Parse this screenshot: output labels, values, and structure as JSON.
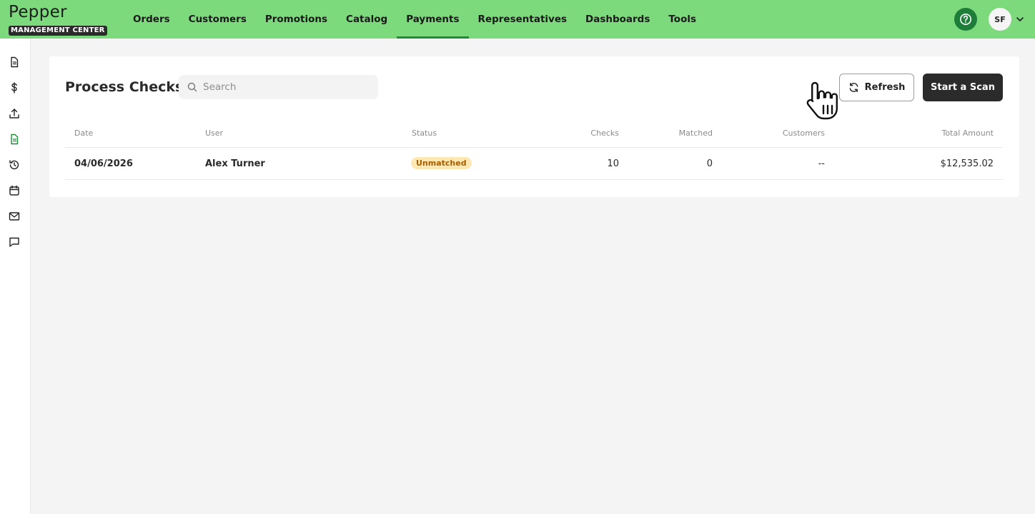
{
  "brand": {
    "name": "Pepper",
    "subtitle": "MANAGEMENT CENTER"
  },
  "nav": [
    {
      "label": "Orders",
      "active": false
    },
    {
      "label": "Customers",
      "active": false
    },
    {
      "label": "Promotions",
      "active": false
    },
    {
      "label": "Catalog",
      "active": false
    },
    {
      "label": "Payments",
      "active": true
    },
    {
      "label": "Representatives",
      "active": false
    },
    {
      "label": "Dashboards",
      "active": false
    },
    {
      "label": "Tools",
      "active": false
    }
  ],
  "user": {
    "initials": "SF"
  },
  "colors": {
    "topbar": "#7cd97c",
    "accent": "#1f8a3a",
    "help": "#1f7d3a",
    "badge_bg": "#fde7b3",
    "badge_text": "#a55e00",
    "primary_button": "#2b2b2b"
  },
  "rail_icons": [
    "document-icon",
    "dollar-icon",
    "upload-icon",
    "check-document-icon",
    "history-icon",
    "calendar-icon",
    "mail-icon",
    "chat-icon"
  ],
  "page": {
    "title": "Process Checks",
    "search": {
      "placeholder": "Search",
      "value": ""
    },
    "refresh_label": "Refresh",
    "scan_label": "Start a Scan"
  },
  "table": {
    "columns": [
      "Date",
      "User",
      "Status",
      "Checks",
      "Matched",
      "Customers",
      "Total Amount"
    ],
    "rows": [
      {
        "date": "04/06/2026",
        "user": "Alex Turner",
        "status": "Unmatched",
        "checks": "10",
        "matched": "0",
        "customers": "--",
        "total": "$12,535.02"
      }
    ]
  }
}
